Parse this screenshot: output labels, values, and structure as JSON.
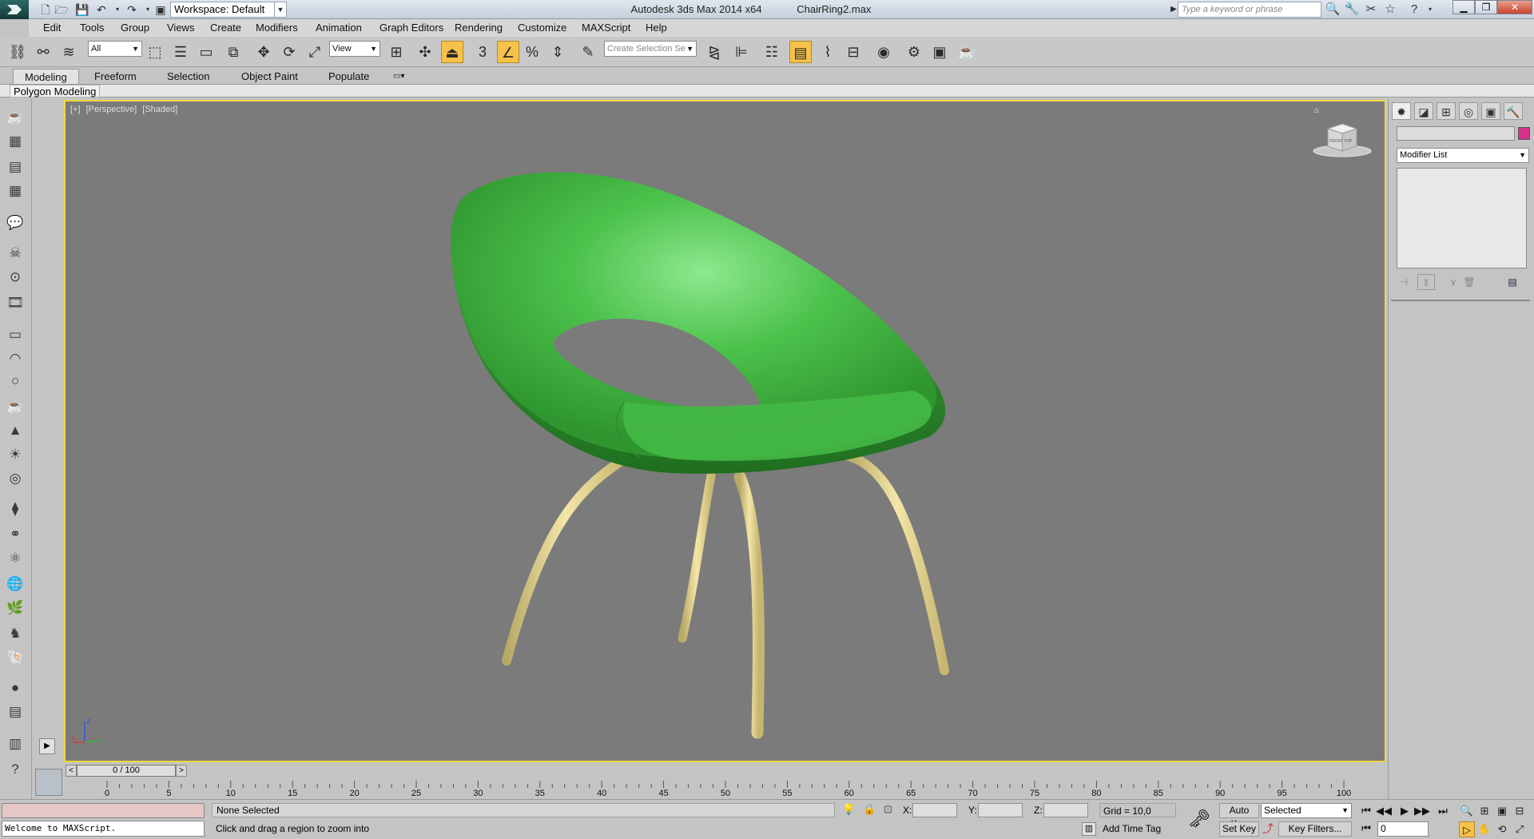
{
  "titlebar": {
    "app_name": "Autodesk 3ds Max  2014 x64",
    "file_name": "ChairRing2.max",
    "workspace": "Workspace: Default",
    "search_placeholder": "Type a keyword or phrase"
  },
  "menu": [
    "Edit",
    "Tools",
    "Group",
    "Views",
    "Create",
    "Modifiers",
    "Animation",
    "Graph Editors",
    "Rendering",
    "Customize",
    "MAXScript",
    "Help"
  ],
  "toolbar": {
    "selection_filter": "All",
    "reference_coord": "View",
    "named_selection_placeholder": "Create Selection Se",
    "snap_toggle_label": "3"
  },
  "ribbon": {
    "tabs": [
      "Modeling",
      "Freeform",
      "Selection",
      "Object Paint",
      "Populate"
    ],
    "active_tab": "Modeling",
    "panel_label": "Polygon Modeling"
  },
  "viewport": {
    "label_plus": "[+]",
    "label_view": "[Perspective]",
    "label_shading": "[Shaded]",
    "viewcube_top": "TOP",
    "viewcube_front": "FRONT",
    "axis_x": "x",
    "axis_y": "y",
    "axis_z": "z"
  },
  "command_panel": {
    "modifier_list": "Modifier List",
    "object_color": "#d8318a"
  },
  "timeline": {
    "frame_display": "0 / 100",
    "prev": "<",
    "next": ">",
    "ticks": [
      0,
      5,
      10,
      15,
      20,
      25,
      30,
      35,
      40,
      45,
      50,
      55,
      60,
      65,
      70,
      75,
      80,
      85,
      90,
      95,
      100
    ]
  },
  "status": {
    "maxscript_welcome": "Welcome to MAXScript.",
    "selection": "None Selected",
    "prompt": "Click and drag a region to zoom into",
    "x_label": "X:",
    "y_label": "Y:",
    "z_label": "Z:",
    "grid": "Grid = 10,0",
    "add_time_tag": "Add Time Tag",
    "auto_key": "Auto Key",
    "set_key": "Set Key",
    "key_mode": "Selected",
    "key_filters": "Key Filters...",
    "current_frame": "0"
  },
  "colors": {
    "viewport_bg": "#7b7b7b",
    "viewport_border": "#f0d840",
    "seat_green": "#3fb03f",
    "leg_cream": "#e6d48c"
  }
}
